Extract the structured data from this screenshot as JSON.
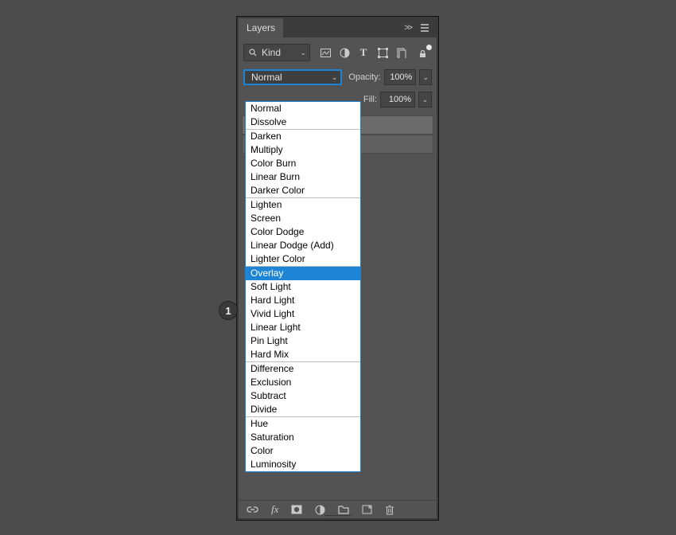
{
  "panel": {
    "title": "Layers"
  },
  "filter": {
    "kind_label": "Kind"
  },
  "blend": {
    "selected": "Normal",
    "opacity_label": "Opacity:",
    "opacity_value": "100%",
    "fill_label": "Fill:",
    "fill_value": "100%",
    "groups": [
      [
        "Normal",
        "Dissolve"
      ],
      [
        "Darken",
        "Multiply",
        "Color Burn",
        "Linear Burn",
        "Darker Color"
      ],
      [
        "Lighten",
        "Screen",
        "Color Dodge",
        "Linear Dodge (Add)",
        "Lighter Color"
      ],
      [
        "Overlay",
        "Soft Light",
        "Hard Light",
        "Vivid Light",
        "Linear Light",
        "Pin Light",
        "Hard Mix"
      ],
      [
        "Difference",
        "Exclusion",
        "Subtract",
        "Divide"
      ],
      [
        "Hue",
        "Saturation",
        "Color",
        "Luminosity"
      ]
    ],
    "highlighted": "Overlay"
  },
  "callout": {
    "label": "1"
  }
}
